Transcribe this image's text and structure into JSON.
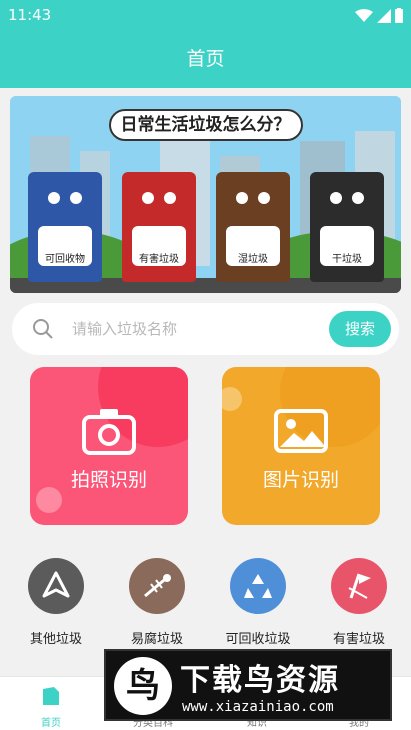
{
  "status_bar": {
    "time": "11:43"
  },
  "header": {
    "title": "首页"
  },
  "banner": {
    "heading": "日常生活垃圾怎么分？",
    "bins": [
      {
        "label": "可回收物",
        "color": "#2f57a8"
      },
      {
        "label": "有害垃圾",
        "color": "#c42a2a"
      },
      {
        "label": "湿垃圾",
        "color": "#6b3f22"
      },
      {
        "label": "干垃圾",
        "color": "#2c2c2c"
      }
    ]
  },
  "search": {
    "placeholder": "请输入垃圾名称",
    "value": "",
    "button": "搜索"
  },
  "actions": [
    {
      "label": "拍照识别",
      "icon": "camera-icon",
      "color": "#fb5677"
    },
    {
      "label": "图片识别",
      "icon": "image-icon",
      "color": "#f2a82a"
    }
  ],
  "categories": [
    {
      "label": "其他垃圾",
      "icon": "other-waste-icon",
      "color": "#5b5b5b"
    },
    {
      "label": "易腐垃圾",
      "icon": "fish-bone-icon",
      "color": "#8a6a5a"
    },
    {
      "label": "可回收垃圾",
      "icon": "recycle-icon",
      "color": "#4f8fd8"
    },
    {
      "label": "有害垃圾",
      "icon": "hazard-icon",
      "color": "#e8556a"
    }
  ],
  "tabbar": {
    "tabs": [
      {
        "label": "首页"
      },
      {
        "label": "分类百科"
      },
      {
        "label": "知识"
      },
      {
        "label": "我的"
      }
    ]
  },
  "watermark": {
    "logo_char": "鸟",
    "title": "下载鸟资源",
    "url": "www.xiazainiao.com"
  },
  "colors": {
    "accent": "#3dd2c6"
  }
}
